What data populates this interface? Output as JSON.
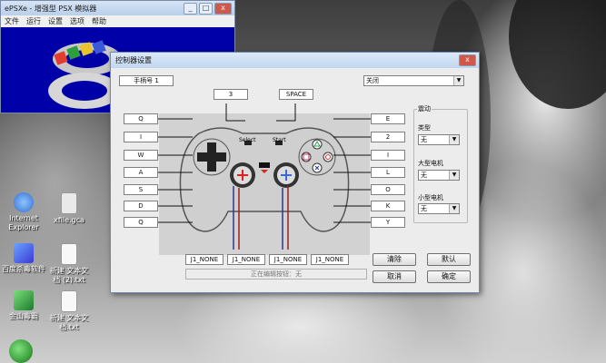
{
  "desktop": {
    "icons": [
      {
        "label": "Internet Explorer",
        "color": "#2f6fd1"
      },
      {
        "label": "xfile.gca",
        "color": "#e9e9e9"
      },
      {
        "label": "百度杀毒软件",
        "color": "#3a7bd5"
      },
      {
        "label": "新建 文本文档 (2).txt",
        "color": "#f3f3f3"
      },
      {
        "label": "金山毒霸",
        "color": "#3fa34d"
      },
      {
        "label": "新建 文本文档.txt",
        "color": "#f3f3f3"
      }
    ]
  },
  "epsxe_window": {
    "title": "ePSXe - 增强型 PSX 模拟器",
    "menu": [
      "文件",
      "运行",
      "设置",
      "选项",
      "帮助"
    ],
    "controls": {
      "minimize": "_",
      "maximize": "□",
      "close": "x"
    }
  },
  "dialog": {
    "title": "控制器设置",
    "close": "x",
    "controller_select": "手柄号 1",
    "type_select": "关闭",
    "top_fields": {
      "l2": "3",
      "r2": "SPACE"
    },
    "left_keys": [
      "Q",
      "I",
      "W",
      "A",
      "S",
      "D",
      "Q"
    ],
    "right_keys": [
      "E",
      "2",
      "I",
      "L",
      "O",
      "K",
      "Y"
    ],
    "select_label": "Select",
    "start_label": "Start",
    "bottom_fields": [
      "J1_NONE",
      "J1_NONE",
      "J1_NONE",
      "J1_NONE"
    ],
    "status_text": "正在编辑按钮：无",
    "vibration": {
      "group_label": "震动",
      "type_label": "类型",
      "type_value": "无",
      "big_motor_label": "大型电机",
      "big_motor_value": "无",
      "small_motor_label": "小型电机",
      "small_motor_value": "无"
    },
    "buttons": {
      "clear": "清除",
      "default": "默认",
      "cancel": "取消",
      "ok": "确定"
    }
  }
}
